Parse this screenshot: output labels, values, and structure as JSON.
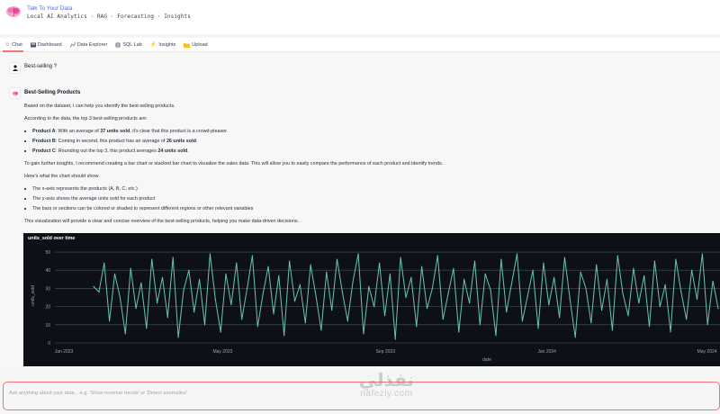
{
  "app": {
    "title": "Talk To Your Data",
    "subtitle": "Local AI Analytics · RAG · Forecasting · Insights"
  },
  "tabs": [
    {
      "label": "Chat",
      "icon": "chat-icon",
      "active": true
    },
    {
      "label": "Dashboard",
      "icon": "dashboard-icon",
      "active": false
    },
    {
      "label": "Data Explorer",
      "icon": "explorer-icon",
      "active": false
    },
    {
      "label": "SQL Lab",
      "icon": "database-icon",
      "active": false
    },
    {
      "label": "Insights",
      "icon": "lightning-icon",
      "active": false
    },
    {
      "label": "Upload",
      "icon": "folder-icon",
      "active": false
    }
  ],
  "conversation": {
    "user_message": "Best-selling ?",
    "answer": {
      "heading": "Best-Selling Products",
      "p1": "Based on the dataset, I can help you identify the best-selling products.",
      "p2": "According to the data, the top 3 best-selling products are:",
      "products": [
        {
          "name": "Product A",
          "pre": ": With an average of ",
          "value": "37 units sold",
          "post": ", it's clear that this product is a crowd-pleaser."
        },
        {
          "name": "Product B",
          "pre": ": Coming in second, this product has an average of ",
          "value": "26 units sold",
          "post": "."
        },
        {
          "name": "Product C",
          "pre": ": Rounding out the top 3, this product averages ",
          "value": "24 units sold",
          "post": "."
        }
      ],
      "p3": "To gain further insights, I recommend creating a bar chart or stacked bar chart to visualize the sales data. This will allow you to easily compare the performance of each product and identify trends.",
      "p4": "Here's what the chart should show:",
      "chart_points": [
        "The x-axis represents the products (A, B, C, etc.)",
        "The y-axis shows the average units sold for each product",
        "The bars or sections can be colored or shaded to represent different regions or other relevant variables"
      ],
      "p5": "This visualization will provide a clear and concise overview of the best-selling products, helping you make data-driven decisions."
    }
  },
  "chart_data": {
    "type": "line",
    "title": "units_sold over time",
    "xlabel": "date",
    "ylabel": "units_sold",
    "x_ticks": [
      "Jan 2023",
      "May 2023",
      "Sep 2023",
      "Jan 2024",
      "May 2024"
    ],
    "y_ticks": [
      0,
      10,
      20,
      30,
      40,
      50
    ],
    "ylim": [
      0,
      52
    ],
    "grid": true,
    "line_color": "#6bc4b4",
    "background": "#0d1117",
    "x": [
      "2023-01-01",
      "2023-01-05",
      "2023-01-09",
      "2023-01-13",
      "2023-01-17",
      "2023-01-21",
      "2023-01-25",
      "2023-01-29",
      "2023-02-02",
      "2023-02-06",
      "2023-02-10",
      "2023-02-14",
      "2023-02-18",
      "2023-02-22",
      "2023-02-26",
      "2023-03-02",
      "2023-03-06",
      "2023-03-10",
      "2023-03-14",
      "2023-03-18",
      "2023-03-22",
      "2023-03-26",
      "2023-03-30",
      "2023-04-03",
      "2023-04-07",
      "2023-04-11",
      "2023-04-15",
      "2023-04-19",
      "2023-04-23",
      "2023-04-27",
      "2023-05-01",
      "2023-05-05",
      "2023-05-09",
      "2023-05-13",
      "2023-05-17",
      "2023-05-21",
      "2023-05-25",
      "2023-05-29",
      "2023-06-02",
      "2023-06-06",
      "2023-06-10",
      "2023-06-14",
      "2023-06-18",
      "2023-06-22",
      "2023-06-26",
      "2023-06-30",
      "2023-07-04",
      "2023-07-08",
      "2023-07-12",
      "2023-07-16",
      "2023-07-20",
      "2023-07-24",
      "2023-07-28",
      "2023-08-01",
      "2023-08-05",
      "2023-08-09",
      "2023-08-13",
      "2023-08-17",
      "2023-08-21",
      "2023-08-25",
      "2023-08-29",
      "2023-09-02",
      "2023-09-06",
      "2023-09-10",
      "2023-09-14",
      "2023-09-18",
      "2023-09-22",
      "2023-09-26",
      "2023-09-30",
      "2023-10-04",
      "2023-10-08",
      "2023-10-12",
      "2023-10-16",
      "2023-10-20",
      "2023-10-24",
      "2023-10-28",
      "2023-11-01",
      "2023-11-05",
      "2023-11-09",
      "2023-11-13",
      "2023-11-17",
      "2023-11-21",
      "2023-11-25",
      "2023-11-29",
      "2023-12-03",
      "2023-12-07",
      "2023-12-11",
      "2023-12-15",
      "2023-12-19",
      "2023-12-23",
      "2023-12-27",
      "2023-12-31",
      "2024-01-04",
      "2024-01-08",
      "2024-01-12",
      "2024-01-16",
      "2024-01-20",
      "2024-01-24",
      "2024-01-28",
      "2024-02-01",
      "2024-02-05",
      "2024-02-09",
      "2024-02-13",
      "2024-02-17",
      "2024-02-21",
      "2024-02-25",
      "2024-02-29",
      "2024-03-04",
      "2024-03-08",
      "2024-03-12",
      "2024-03-16",
      "2024-03-20",
      "2024-03-24",
      "2024-03-28",
      "2024-04-01",
      "2024-04-05",
      "2024-04-09",
      "2024-04-13",
      "2024-04-17",
      "2024-04-21",
      "2024-04-25",
      "2024-04-29",
      "2024-05-03",
      "2024-05-07",
      "2024-05-11",
      "2024-05-15",
      "2024-05-19",
      "2024-05-23",
      "2024-05-27",
      "2024-05-31",
      "2024-06-04",
      "2024-06-08",
      "2024-06-12",
      "2024-06-16",
      "2024-06-20",
      "2024-06-24",
      "2024-06-28",
      "2024-07-02",
      "2024-07-06",
      "2024-07-10"
    ],
    "values": [
      31,
      28,
      44,
      12,
      38,
      25,
      5,
      41,
      19,
      33,
      8,
      46,
      22,
      36,
      14,
      47,
      3,
      29,
      40,
      17,
      35,
      10,
      49,
      24,
      6,
      38,
      21,
      44,
      13,
      30,
      48,
      9,
      27,
      42,
      16,
      37,
      4,
      45,
      23,
      32,
      11,
      43,
      26,
      7,
      39,
      18,
      46,
      28,
      12,
      34,
      49,
      5,
      31,
      20,
      44,
      15,
      38,
      2,
      47,
      25,
      36,
      9,
      42,
      19,
      30,
      48,
      13,
      27,
      41,
      6,
      35,
      22,
      45,
      10,
      38,
      29,
      4,
      46,
      17,
      33,
      49,
      12,
      26,
      40,
      8,
      44,
      21,
      36,
      14,
      47,
      24,
      3,
      39,
      30,
      11,
      43,
      18,
      35,
      7,
      48,
      27,
      15,
      41,
      22,
      37,
      9,
      45,
      20,
      32,
      6,
      46,
      28,
      13,
      40,
      24,
      49,
      10,
      34,
      19,
      43,
      5,
      38,
      26,
      47,
      15,
      30,
      42,
      8,
      36,
      22,
      45,
      12,
      33,
      48,
      18,
      27,
      40,
      23
    ],
    "partial_points": [
      20,
      34,
      9,
      38,
      16
    ]
  },
  "input": {
    "placeholder": "Ask anything about your data... e.g. 'Show revenue trends' or 'Detect anomalies'"
  },
  "watermark": {
    "arabic": "نفذلي",
    "latin": "nafezly.com"
  }
}
